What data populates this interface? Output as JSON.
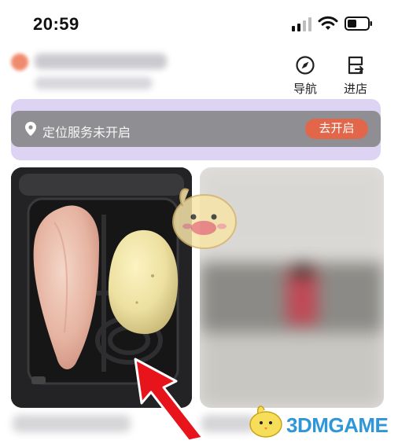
{
  "status_bar": {
    "time": "20:59"
  },
  "header": {
    "nav_label": "导航",
    "shop_label": "进店",
    "nav_icon": "compass-icon",
    "shop_icon": "storefront-icon"
  },
  "location_banner": {
    "text": "定位服务未开启",
    "button_label": "去开启",
    "icon": "location-pin-icon"
  },
  "watermark": {
    "text": "3DMGAME"
  },
  "colors": {
    "banner_bg": "#8f8f93",
    "button_bg": "#e2664a",
    "banner_frame": "#ddd4f4",
    "arrow": "#e8141c"
  }
}
